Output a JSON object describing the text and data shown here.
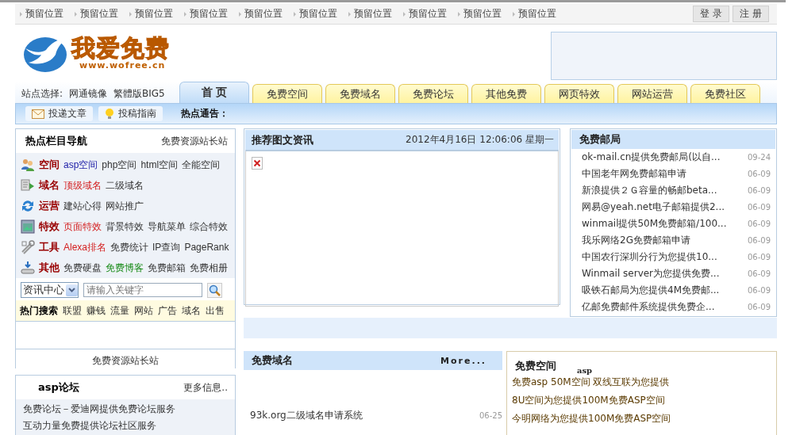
{
  "top_nav": {
    "items": [
      "预留位置",
      "预留位置",
      "预留位置",
      "预留位置",
      "预留位置",
      "预留位置",
      "预留位置",
      "预留位置",
      "预留位置",
      "预留位置"
    ],
    "buttons": [
      "登 录",
      "注 册"
    ]
  },
  "logo": {
    "title": "我爱免费",
    "url": "www.wofree.cn"
  },
  "site_select": {
    "label": "站点选择:",
    "options": [
      "网通镜像",
      "繁體版BIG5"
    ]
  },
  "tabs": [
    {
      "label": "首 页",
      "selected": true
    },
    {
      "label": "免费空间",
      "selected": false
    },
    {
      "label": "免费域名",
      "selected": false
    },
    {
      "label": "免费论坛",
      "selected": false
    },
    {
      "label": "其他免费",
      "selected": false
    },
    {
      "label": "网页特效",
      "selected": false
    },
    {
      "label": "网站运营",
      "selected": false
    },
    {
      "label": "免费社区",
      "selected": false
    }
  ],
  "toolbar": {
    "buttons": [
      "投递文章",
      "投稿指南"
    ],
    "notice_label": "热点通告："
  },
  "nav_panel": {
    "title": "热点栏目导航",
    "link": "免费资源站长站",
    "categories": [
      {
        "name": "空间",
        "links": [
          {
            "text": "asp空间",
            "kind": "featured"
          },
          {
            "text": "php空间",
            "kind": "plain"
          },
          {
            "text": "html空间",
            "kind": "plain"
          },
          {
            "text": "全能空间",
            "kind": "plain"
          }
        ]
      },
      {
        "name": "域名",
        "links": [
          {
            "text": "顶级域名",
            "kind": "hot"
          },
          {
            "text": "二级域名",
            "kind": "plain"
          }
        ]
      },
      {
        "name": "运营",
        "links": [
          {
            "text": "建站心得",
            "kind": "plain"
          },
          {
            "text": "网站推广",
            "kind": "plain"
          }
        ]
      },
      {
        "name": "特效",
        "links": [
          {
            "text": "页面特效",
            "kind": "hot"
          },
          {
            "text": "背景特效",
            "kind": "plain"
          },
          {
            "text": "导航菜单",
            "kind": "plain"
          },
          {
            "text": "综合特效",
            "kind": "plain"
          }
        ]
      },
      {
        "name": "工具",
        "links": [
          {
            "text": "Alexa排名",
            "kind": "hot"
          },
          {
            "text": "免费统计",
            "kind": "plain"
          },
          {
            "text": "IP查询",
            "kind": "plain"
          },
          {
            "text": "PageRank",
            "kind": "plain"
          }
        ]
      },
      {
        "name": "其他",
        "links": [
          {
            "text": "免费硬盘",
            "kind": "plain"
          },
          {
            "text": "免费博客",
            "kind": "new"
          },
          {
            "text": "免费邮箱",
            "kind": "plain"
          },
          {
            "text": "免费相册",
            "kind": "plain"
          }
        ]
      }
    ],
    "search": {
      "category": "资讯中心",
      "placeholder": "请输入关键字"
    },
    "hot_search": {
      "label": "热门搜索",
      "terms": [
        "联盟",
        "赚钱",
        "流量",
        "网站",
        "广告",
        "域名",
        "出售"
      ]
    },
    "footer": "免费资源站长站"
  },
  "forum_panel": {
    "title": "asp论坛",
    "more": "更多信息..",
    "items": [
      "免费论坛－爱迪网提供免费论坛服务",
      "互动力量免费提供论坛社区服务"
    ]
  },
  "featured_panel": {
    "title": "推荐图文资讯",
    "datetime": "2012年4月16日 12:06:06 星期一"
  },
  "mail_panel": {
    "title": "免费邮局",
    "items": [
      {
        "text": "ok-mail.cn提供免费邮局(以自...",
        "date": "09-24"
      },
      {
        "text": "中国老年网免费邮箱申请",
        "date": "06-09"
      },
      {
        "text": "新浪提供２Ｇ容量的畅邮beta...",
        "date": "06-09"
      },
      {
        "text": "网易@yeah.net电子邮箱提供2...",
        "date": "06-09"
      },
      {
        "text": "winmail提供50M免费邮箱/100...",
        "date": "06-09"
      },
      {
        "text": "我乐网络2G免费邮箱申请",
        "date": "06-09"
      },
      {
        "text": "中国农行深圳分行为您提供10...",
        "date": "06-09"
      },
      {
        "text": "Winmail server为您提供免费...",
        "date": "06-09"
      },
      {
        "text": "吸铁石邮局为您提供4M免费邮...",
        "date": "06-09"
      },
      {
        "text": "亿邮免费邮件系统提供免费企...",
        "date": "06-09"
      }
    ]
  },
  "domain_panel": {
    "title": "免费域名",
    "more": "More...",
    "items": [
      {
        "text": "93k.org二级域名申请系统",
        "date": "06-25"
      }
    ]
  },
  "space_panel": {
    "title": "免费空间",
    "subtitle": "asp",
    "items": [
      "免费asp 50M空间 双线互联为您提供",
      "8U空间为您提供100M免费ASP空间",
      "今明网络为您提供100M免费ASP空间"
    ]
  }
}
